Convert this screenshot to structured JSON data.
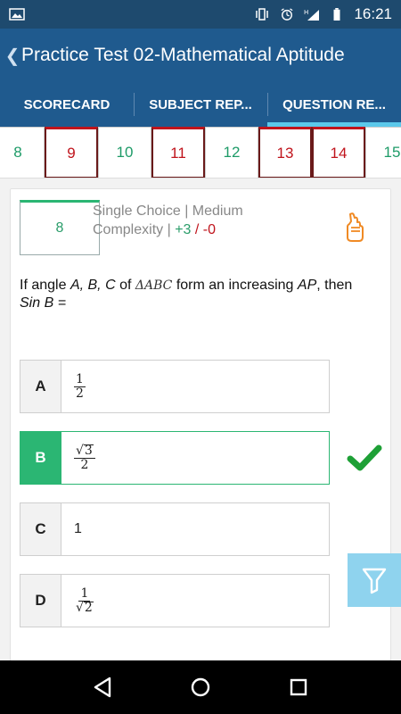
{
  "status_bar": {
    "time": "16:21",
    "icons": [
      "image-icon",
      "vibrate-icon",
      "alarm-icon",
      "signal-h-icon",
      "signal-icon",
      "battery-icon"
    ]
  },
  "app_bar": {
    "title": "Practice Test 02-Mathematical Aptitude",
    "back_icon": "chevron-left-icon"
  },
  "tabs": [
    {
      "label": "SCORECARD",
      "active": false
    },
    {
      "label": "SUBJECT REP...",
      "active": false
    },
    {
      "label": "QUESTION RE...",
      "active": true
    }
  ],
  "question_strip": [
    {
      "number": "8",
      "status": "correct"
    },
    {
      "number": "9",
      "status": "wrong"
    },
    {
      "number": "10",
      "status": "correct"
    },
    {
      "number": "11",
      "status": "wrong"
    },
    {
      "number": "12",
      "status": "correct"
    },
    {
      "number": "13",
      "status": "wrong"
    },
    {
      "number": "14",
      "status": "wrong"
    },
    {
      "number": "15",
      "status": "correct"
    }
  ],
  "question": {
    "number": "8",
    "type": "Single Choice",
    "separator": "|",
    "complexity": "Medium Complexity",
    "marks_positive": "+3",
    "marks_negative": "/ -0",
    "text_part1": "If angle",
    "angles": "A, B, C",
    "text_part2": "of",
    "triangle": "ΔABC",
    "text_part3": "form  an increasing",
    "ap": "AP",
    "text_part4": ", then",
    "sinb": "Sin B =",
    "hint_icon": "hand-fingers-crossed-icon"
  },
  "options": [
    {
      "label": "A",
      "value": "1/2",
      "selected": false
    },
    {
      "label": "B",
      "value": "√3/2",
      "selected": true
    },
    {
      "label": "C",
      "value": "1",
      "selected": false
    },
    {
      "label": "D",
      "value": "1/√2",
      "selected": false
    }
  ],
  "option_math": {
    "a_num": "1",
    "a_den": "2",
    "b_root": "3",
    "b_den": "2",
    "c_text": "1",
    "d_num": "1",
    "d_root": "2"
  },
  "colors": {
    "status_bar": "#1e4a6e",
    "app_bar": "#1f5a8e",
    "tab_indicator": "#5bc8ea",
    "correct": "#2bb673",
    "wrong": "#c0141c",
    "hint": "#f08a24",
    "filter_button": "#8fd3ee"
  },
  "nav": [
    "back-triangle-icon",
    "home-circle-icon",
    "recents-square-icon"
  ]
}
